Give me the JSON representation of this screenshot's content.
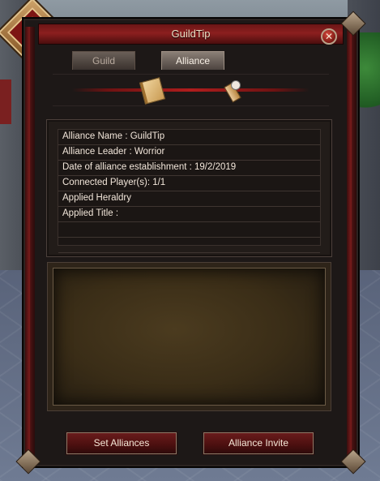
{
  "window": {
    "title": "GuildTip",
    "close_symbol": "✕"
  },
  "tabs": [
    {
      "label": "Guild",
      "active": false
    },
    {
      "label": "Alliance",
      "active": true
    }
  ],
  "icons": {
    "left": "book-icon",
    "right": "scroll-seal-icon"
  },
  "alliance_info": {
    "rows": [
      "Alliance Name : GuildTip",
      "Alliance Leader : Worrior",
      "Date of alliance establishment : 19/2/2019",
      "Connected Player(s): 1/1",
      "Applied Heraldry",
      "Applied Title :",
      "",
      ""
    ]
  },
  "buttons": {
    "set_alliances": "Set Alliances",
    "alliance_invite": "Alliance Invite"
  },
  "colors": {
    "accent_red": "#8c1f1f",
    "panel": "#221c19",
    "text": "#f2e6da"
  }
}
